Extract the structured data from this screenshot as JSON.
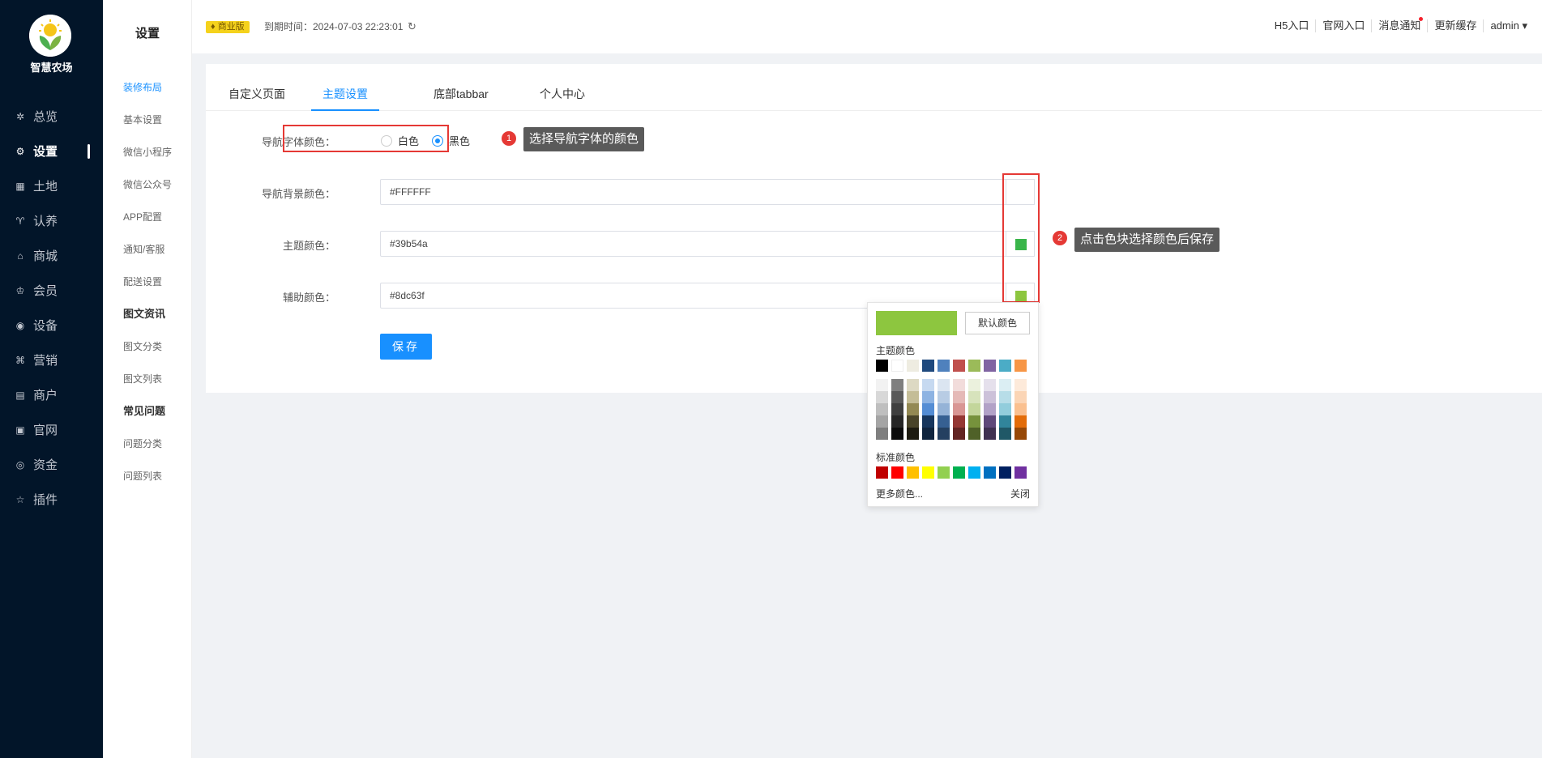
{
  "brand": {
    "name": "智慧农场"
  },
  "nav": [
    {
      "label": "总览",
      "icon": "dashboard-icon",
      "glyph": "✲"
    },
    {
      "label": "设置",
      "icon": "gear-icon",
      "glyph": "⚙"
    },
    {
      "label": "土地",
      "icon": "grid-icon",
      "glyph": "▦"
    },
    {
      "label": "认养",
      "icon": "sprout-icon",
      "glyph": "♈"
    },
    {
      "label": "商城",
      "icon": "shop-icon",
      "glyph": "⌂"
    },
    {
      "label": "会员",
      "icon": "crown-icon",
      "glyph": "♔"
    },
    {
      "label": "设备",
      "icon": "location-icon",
      "glyph": "◉"
    },
    {
      "label": "营销",
      "icon": "marketing-icon",
      "glyph": "⌘"
    },
    {
      "label": "商户",
      "icon": "store-icon",
      "glyph": "▤"
    },
    {
      "label": "官网",
      "icon": "browser-icon",
      "glyph": "▣"
    },
    {
      "label": "资金",
      "icon": "coin-icon",
      "glyph": "◎"
    },
    {
      "label": "插件",
      "icon": "star-icon",
      "glyph": "☆"
    }
  ],
  "submenu": {
    "title": "设置",
    "items": [
      {
        "label": "装修布局",
        "type": "item",
        "active": true
      },
      {
        "label": "基本设置",
        "type": "item"
      },
      {
        "label": "微信小程序",
        "type": "item"
      },
      {
        "label": "微信公众号",
        "type": "item"
      },
      {
        "label": "APP配置",
        "type": "item"
      },
      {
        "label": "通知/客服",
        "type": "item"
      },
      {
        "label": "配送设置",
        "type": "item"
      },
      {
        "label": "图文资讯",
        "type": "group"
      },
      {
        "label": "图文分类",
        "type": "item"
      },
      {
        "label": "图文列表",
        "type": "item"
      },
      {
        "label": "常见问题",
        "type": "group"
      },
      {
        "label": "问题分类",
        "type": "item"
      },
      {
        "label": "问题列表",
        "type": "item"
      }
    ]
  },
  "header": {
    "badge": "商业版",
    "expire": "到期时间：2024-07-03 22:23:01",
    "links": [
      "H5入口",
      "官网入口",
      "消息通知",
      "更新缓存",
      "admin ▾"
    ]
  },
  "tabs": [
    "自定义页面",
    "主题设置",
    "底部tabbar",
    "个人中心"
  ],
  "form": {
    "nav_font_label": "导航字体颜色：",
    "radio_white": "白色",
    "radio_black": "黑色",
    "nav_bg_label": "导航背景颜色：",
    "nav_bg_value": "#FFFFFF",
    "theme_label": "主题颜色：",
    "theme_value": "#39b54a",
    "aux_label": "辅助颜色：",
    "aux_value": "#8dc63f",
    "save": "保存"
  },
  "annotations": {
    "step1_num": "1",
    "step1_text": "选择导航字体的颜色",
    "step2_num": "2",
    "step2_text": "点击色块选择颜色后保存"
  },
  "picker": {
    "current_color": "#8dc63f",
    "default_btn": "默认颜色",
    "theme_colors_label": "主题颜色",
    "standard_colors_label": "标准颜色",
    "more": "更多颜色...",
    "close": "关闭",
    "theme_colors": [
      "#000000",
      "#ffffff",
      "#eeece1",
      "#1f497d",
      "#4f81bd",
      "#c0504d",
      "#9bbb59",
      "#8064a2",
      "#4bacc6",
      "#f79646"
    ],
    "shades": [
      [
        "#f2f2f2",
        "#d8d8d8",
        "#bfbfbf",
        "#a5a5a5",
        "#7f7f7f"
      ],
      [
        "#7f7f7f",
        "#595959",
        "#3f3f3f",
        "#262626",
        "#0c0c0c"
      ],
      [
        "#ddd9c3",
        "#c4bd97",
        "#938953",
        "#494429",
        "#1d1b10"
      ],
      [
        "#c6d9f0",
        "#8db3e2",
        "#548dd4",
        "#17365d",
        "#0f243e"
      ],
      [
        "#dbe5f1",
        "#b8cce4",
        "#95b3d7",
        "#366092",
        "#244061"
      ],
      [
        "#f2dcdb",
        "#e5b9b7",
        "#d99694",
        "#953734",
        "#632423"
      ],
      [
        "#ebf1dd",
        "#d7e3bc",
        "#c3d69b",
        "#76923c",
        "#4f6128"
      ],
      [
        "#e5e0ec",
        "#ccc1d9",
        "#b2a2c7",
        "#5f497a",
        "#3f3151"
      ],
      [
        "#dbeef3",
        "#b7dde8",
        "#92cddc",
        "#31859b",
        "#205867"
      ],
      [
        "#fdeada",
        "#fbd5b5",
        "#fac08f",
        "#e36c09",
        "#974806"
      ]
    ],
    "standard_colors": [
      "#c00000",
      "#ff0000",
      "#ffc000",
      "#ffff00",
      "#92d050",
      "#00b050",
      "#00b0f0",
      "#0070c0",
      "#002060",
      "#7030a0"
    ]
  },
  "colors": {
    "accent": "#1890ff",
    "sidebar": "#021529",
    "annotation": "#e53935",
    "theme_swatch": "#39b54a",
    "aux_swatch": "#8dc63f"
  }
}
